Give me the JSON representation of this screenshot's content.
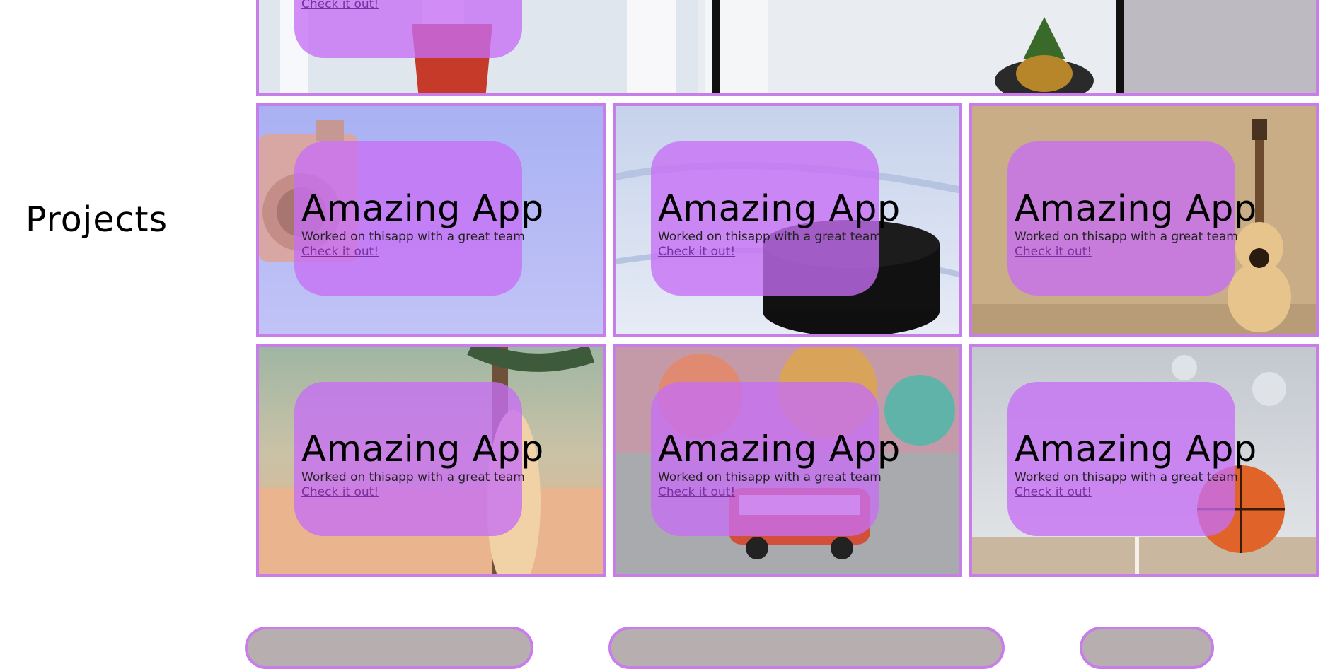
{
  "section": {
    "title": "Projects"
  },
  "top_project": {
    "link": "Check it out!"
  },
  "projects": [
    {
      "title": "Amazing App",
      "description": "Worked on thisapp with a great team",
      "link": "Check it out!",
      "image": "camera"
    },
    {
      "title": "Amazing App",
      "description": "Worked on thisapp with a great team",
      "link": "Check it out!",
      "image": "hockey-puck"
    },
    {
      "title": "Amazing App",
      "description": "Worked on thisapp with a great team",
      "link": "Check it out!",
      "image": "guitar"
    },
    {
      "title": "Amazing App",
      "description": "Worked on thisapp with a great team",
      "link": "Check it out!",
      "image": "beach-surfboard"
    },
    {
      "title": "Amazing App",
      "description": "Worked on thisapp with a great team",
      "link": "Check it out!",
      "image": "toy-van"
    },
    {
      "title": "Amazing App",
      "description": "Worked on thisapp with a great team",
      "link": "Check it out!",
      "image": "basketball"
    }
  ],
  "colors": {
    "accent": "#c77ee8",
    "overlay": "#c76ef5"
  }
}
